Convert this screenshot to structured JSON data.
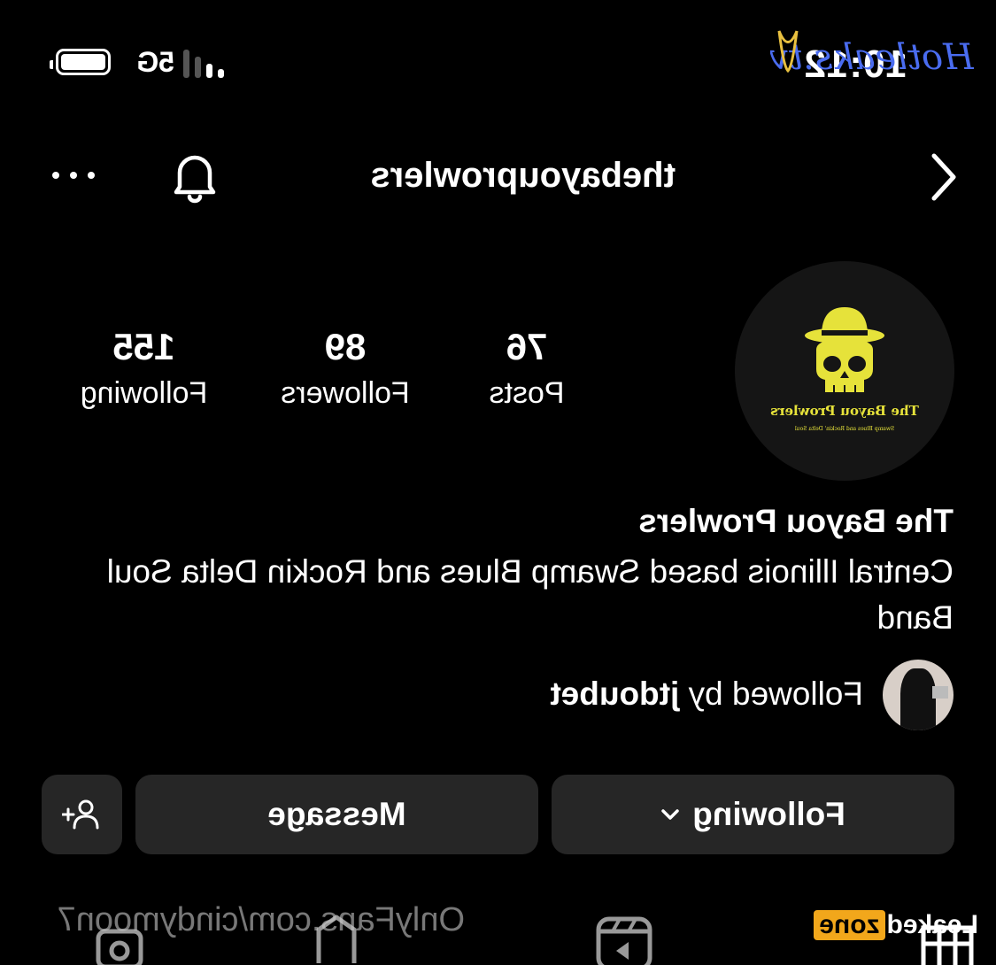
{
  "status_bar": {
    "time": "10:12",
    "network": "5G"
  },
  "header": {
    "username": "thebayouprowlers",
    "icons": [
      "back-chevron-icon",
      "bell-icon",
      "more-dots-icon"
    ]
  },
  "avatar": {
    "title": "The Bayou Prowlers",
    "subtitle": "Swamp Blues and Rockin' Delta Soul",
    "accent_color": "#e6e23a"
  },
  "stats": [
    {
      "id": "posts",
      "value": "76",
      "label": "Posts"
    },
    {
      "id": "followers",
      "value": "89",
      "label": "Followers"
    },
    {
      "id": "following",
      "value": "155",
      "label": "Following"
    }
  ],
  "bio": {
    "display_name": "The Bayou Prowlers",
    "text": "Central Illinois based Swamp Blues and Rockin Delta Soul Band",
    "followed_by_prefix": "Followed by ",
    "followed_by_user": "jtdoubet"
  },
  "actions": {
    "following_label": "Following",
    "message_label": "Message",
    "add_user_icon": "add-user-icon"
  },
  "tabs": [
    "grid-icon",
    "reels-icon",
    "tagged-icon",
    "camera-icon"
  ],
  "watermarks": {
    "onlyfans": "OnlyFans.com/cindymoon7",
    "leaked_a": "Leaked",
    "leaked_b": "zone",
    "hotleaks": "Hotleaks.tv"
  }
}
